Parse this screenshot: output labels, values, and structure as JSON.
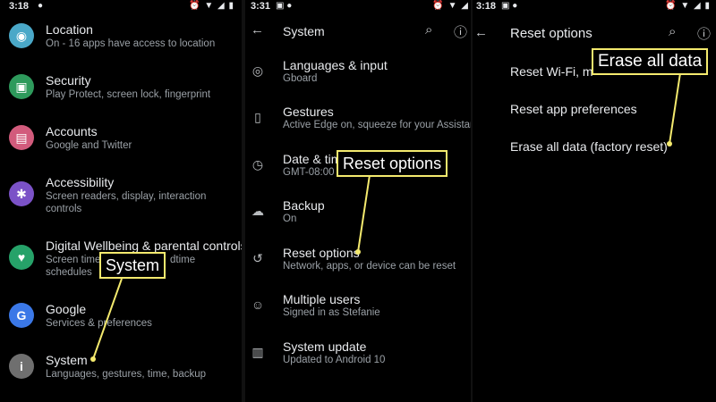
{
  "colors": {
    "highlight": "#f4ea6e",
    "background": "#000000",
    "location": "#4aa8c8",
    "security": "#2e9a5c",
    "accounts": "#d25b7c",
    "accessibility": "#7b52c7",
    "wellbeing": "#26a269",
    "google": "#3b78e7",
    "system": "#6f6f6f"
  },
  "panel1": {
    "time": "3:18",
    "items": [
      {
        "title": "Location",
        "subtitle": "On - 16 apps have access to location",
        "icon": "location-pin-icon"
      },
      {
        "title": "Security",
        "subtitle": "Play Protect, screen lock, fingerprint",
        "icon": "lock-icon"
      },
      {
        "title": "Accounts",
        "subtitle": "Google and Twitter",
        "icon": "account-icon"
      },
      {
        "title": "Accessibility",
        "subtitle_line1": "Screen readers, display, interaction",
        "subtitle_line2": "controls",
        "icon": "accessibility-icon"
      },
      {
        "title": "Digital Wellbeing & parental controls",
        "subtitle_line1": "Screen time",
        "subtitle_line1b": "dtime",
        "subtitle_line2": "schedules",
        "icon": "wellbeing-icon"
      },
      {
        "title": "Google",
        "subtitle": "Services & preferences",
        "icon": "google-icon"
      },
      {
        "title": "System",
        "subtitle": "Languages, gestures, time, backup",
        "icon": "info-icon"
      }
    ],
    "callout": "System"
  },
  "panel2": {
    "time": "3:31",
    "title": "System",
    "items": [
      {
        "title": "Languages & input",
        "subtitle": "Gboard",
        "icon": "globe-icon"
      },
      {
        "title": "Gestures",
        "subtitle": "Active Edge on, squeeze for your Assistant",
        "icon": "gesture-phone-icon"
      },
      {
        "title": "Date & tim",
        "subtitle": "GMT-08:00 P",
        "icon": "clock-icon"
      },
      {
        "title": "Backup",
        "subtitle": "On",
        "icon": "cloud-backup-icon"
      },
      {
        "title": "Reset options",
        "subtitle": "Network, apps, or device can be reset",
        "icon": "history-icon"
      },
      {
        "title": "Multiple users",
        "subtitle": "Signed in as Stefanie",
        "icon": "person-icon"
      },
      {
        "title": "System update",
        "subtitle": "Updated to Android 10",
        "icon": "system-update-icon"
      }
    ],
    "callout": "Reset options"
  },
  "panel3": {
    "time": "3:18",
    "title": "Reset options",
    "items": [
      {
        "title": "Reset Wi-Fi, m"
      },
      {
        "title": "Reset app preferences"
      },
      {
        "title": "Erase all data (factory reset)"
      }
    ],
    "callout": "Erase all data"
  }
}
